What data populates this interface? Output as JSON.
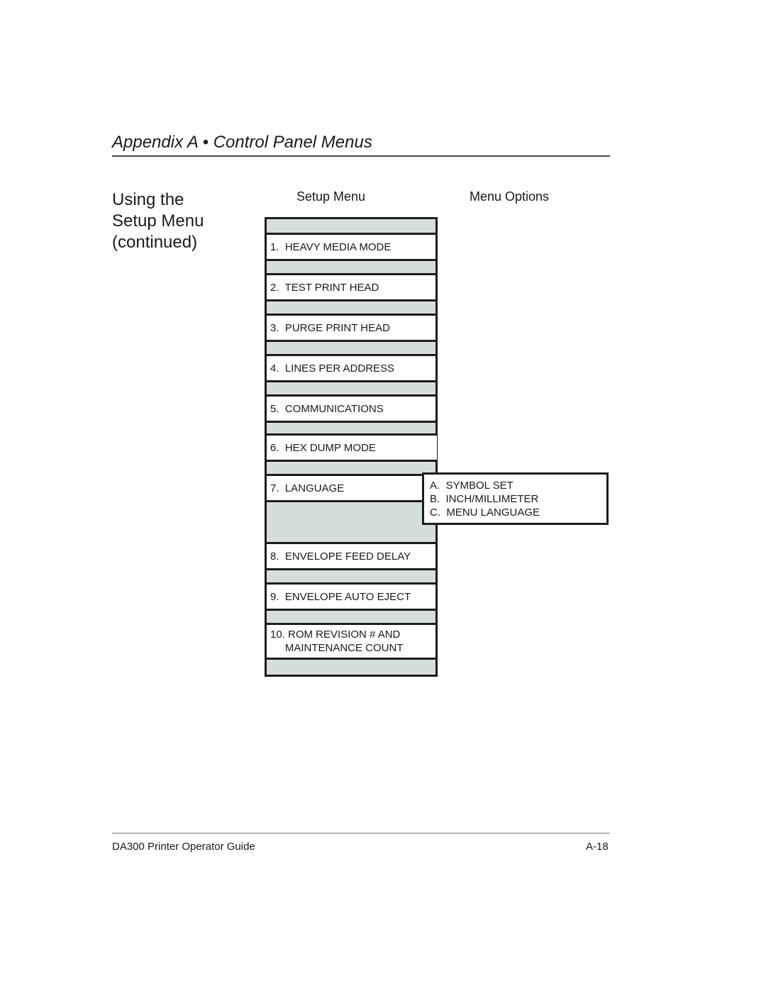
{
  "header": {
    "title": "Appendix A • Control Panel Menus"
  },
  "section": {
    "title_lines": [
      "Using the",
      "Setup Menu",
      "(continued)"
    ]
  },
  "columns": {
    "setup_menu": "Setup Menu",
    "menu_options": "Menu Options"
  },
  "setup_menu_items": [
    {
      "label": "1.  HEAVY MEDIA MODE"
    },
    {
      "label": "2.  TEST PRINT HEAD"
    },
    {
      "label": "3.  PURGE PRINT HEAD"
    },
    {
      "label": "4.  LINES PER ADDRESS"
    },
    {
      "label": "5.  COMMUNICATIONS"
    },
    {
      "label": "6.  HEX DUMP MODE"
    },
    {
      "label": "7.  LANGUAGE"
    },
    {
      "label": "8.  ENVELOPE FEED DELAY"
    },
    {
      "label": "9.  ENVELOPE AUTO EJECT"
    },
    {
      "label": "10. ROM REVISION # AND\n     MAINTENANCE COUNT"
    }
  ],
  "language_options": [
    "A.  SYMBOL SET",
    "B.  INCH/MILLIMETER",
    "C.  MENU LANGUAGE"
  ],
  "footer": {
    "guide_name": "DA300 Printer Operator Guide",
    "page_number": "A-18"
  }
}
